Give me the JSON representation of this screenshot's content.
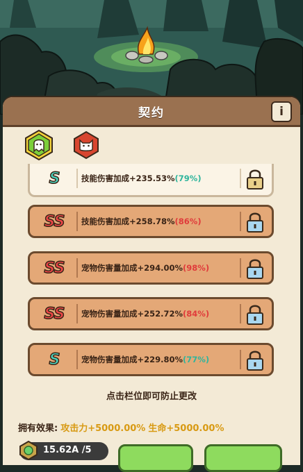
{
  "panel": {
    "title": "契约",
    "info_label": "i"
  },
  "tabs": [
    {
      "name": "ghost",
      "color": "#7ccf3a",
      "active": true
    },
    {
      "name": "cat",
      "color": "#d8462f",
      "active": false
    }
  ],
  "contracts": [
    {
      "grade": "S",
      "label": "技能伤害加成+235.53%",
      "percent": "(79%)",
      "pct_color": "green"
    },
    {
      "grade": "SS",
      "label": "技能伤害加成+258.78%",
      "percent": "(86%)",
      "pct_color": "red"
    },
    {
      "grade": "SS",
      "label": "宠物伤害量加成+294.00%",
      "percent": "(98%)",
      "pct_color": "red"
    },
    {
      "grade": "SS",
      "label": "宠物伤害量加成+252.72%",
      "percent": "(84%)",
      "pct_color": "red"
    },
    {
      "grade": "S",
      "label": "宠物伤害量加成+229.80%",
      "percent": "(77%)",
      "pct_color": "green"
    }
  ],
  "hint": "点击栏位即可防止更改",
  "effects": {
    "label": "拥有效果:",
    "attack": "攻击力+5000.00%",
    "life": "生命+5000.00%"
  },
  "currency": {
    "value": "15.62A /5"
  },
  "colors": {
    "header": "#9a7150",
    "panel": "#f3ead6",
    "row_orange": "#e4a877",
    "grade_s": "#49d2bd",
    "grade_ss": "#ef4747",
    "effect_gold": "#d89a13",
    "button_green": "#8edb5e"
  }
}
